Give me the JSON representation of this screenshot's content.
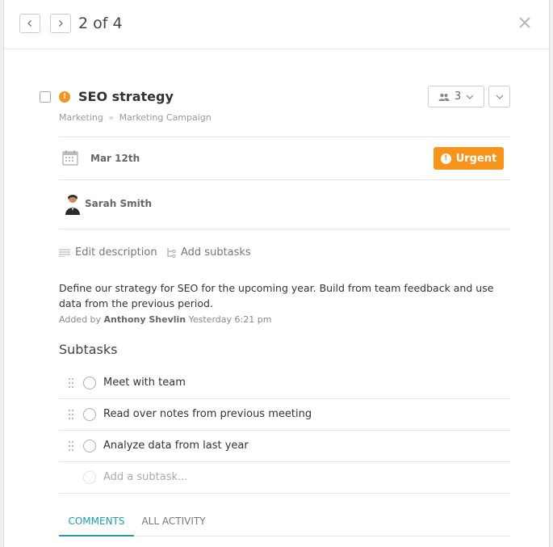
{
  "header": {
    "counter": "2 of 4",
    "prev_icon": "chevron-left-icon",
    "next_icon": "chevron-right-icon",
    "close_icon": "close-icon"
  },
  "task": {
    "title": "SEO strategy",
    "priority_color": "#f7941d",
    "members_count": "3",
    "breadcrumb": [
      "Marketing",
      "Marketing Campaign"
    ],
    "breadcrumb_separator": "»",
    "due_date": "Mar 12th",
    "priority_label": "Urgent",
    "assignee": "Sarah Smith"
  },
  "actions": {
    "edit_description": "Edit description",
    "add_subtasks": "Add subtasks"
  },
  "description": {
    "text": "Define our strategy for SEO for the upcoming year. Build from team feedback and use data from the previous period.",
    "added_by_prefix": "Added by",
    "author": "Anthony Shevlin",
    "timestamp": "Yesterday 6:21 pm"
  },
  "subtasks": {
    "heading": "Subtasks",
    "items": [
      {
        "label": "Meet with team"
      },
      {
        "label": "Read over notes from previous meeting"
      },
      {
        "label": "Analyze data from last year"
      }
    ],
    "add_placeholder": "Add a subtask..."
  },
  "tabs": [
    {
      "label": "COMMENTS",
      "active": true
    },
    {
      "label": "ALL ACTIVITY",
      "active": false
    }
  ],
  "colors": {
    "accent": "#1d9fb1",
    "urgent": "#f7941d"
  }
}
